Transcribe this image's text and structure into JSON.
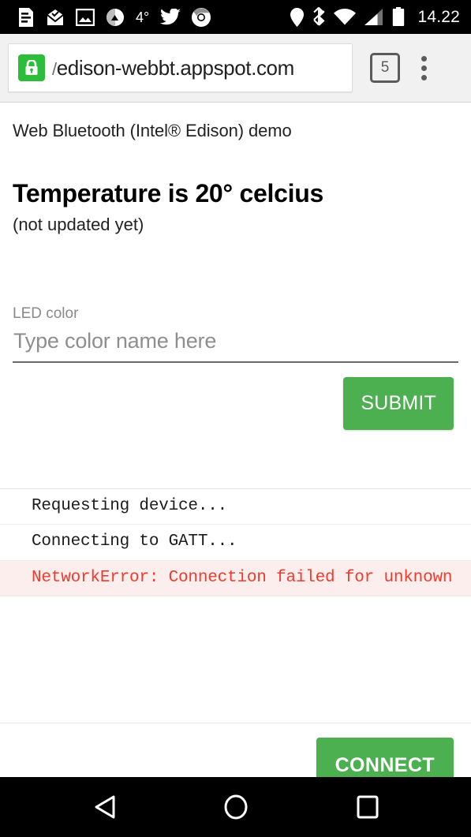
{
  "status_bar": {
    "icons_left": [
      {
        "name": "news-feed-icon",
        "glyph": "feed"
      },
      {
        "name": "mail-open-icon",
        "glyph": "mail"
      },
      {
        "name": "photo-icon",
        "glyph": "photo"
      },
      {
        "name": "weather-app-icon",
        "glyph": "weather"
      },
      {
        "name": "twitter-icon",
        "glyph": "twitter"
      },
      {
        "name": "chrome-icon",
        "glyph": "chrome"
      }
    ],
    "temperature": "4°",
    "icons_right": [
      {
        "name": "location-pin-icon",
        "glyph": "pin"
      },
      {
        "name": "bluetooth-icon",
        "glyph": "bluetooth"
      },
      {
        "name": "wifi-icon",
        "glyph": "wifi"
      },
      {
        "name": "cellular-signal-icon",
        "glyph": "signal"
      },
      {
        "name": "battery-icon",
        "glyph": "battery"
      }
    ],
    "clock": "14.22"
  },
  "browser": {
    "security_icon": "lock-icon",
    "url_prefix": "/",
    "url": "edison-webbt.appspot.com",
    "tab_count": "5",
    "menu_icon": "overflow-menu-icon"
  },
  "page": {
    "site_title": "Web Bluetooth (Intel® Edison) demo",
    "temperature_heading": "Temperature is 20° celcius",
    "temperature_status": "(not updated yet)",
    "led": {
      "label": "LED color",
      "placeholder": "Type color name here",
      "value": ""
    },
    "submit_label": "SUBMIT",
    "connect_label": "CONNECT",
    "log": [
      {
        "text": "Requesting device...",
        "level": "info"
      },
      {
        "text": "Connecting to GATT...",
        "level": "info"
      },
      {
        "text": "NetworkError: Connection failed for unknown",
        "level": "error"
      }
    ]
  },
  "nav_bar": {
    "back": "back-button",
    "home": "home-button",
    "recents": "recents-button"
  },
  "colors": {
    "accent_green": "#4caf50",
    "lock_green": "#2cbd3b",
    "error_red": "#ef3b2d",
    "error_bg": "#fdeeee",
    "chrome_bg": "#f1f1f1",
    "system_black": "#000000"
  }
}
